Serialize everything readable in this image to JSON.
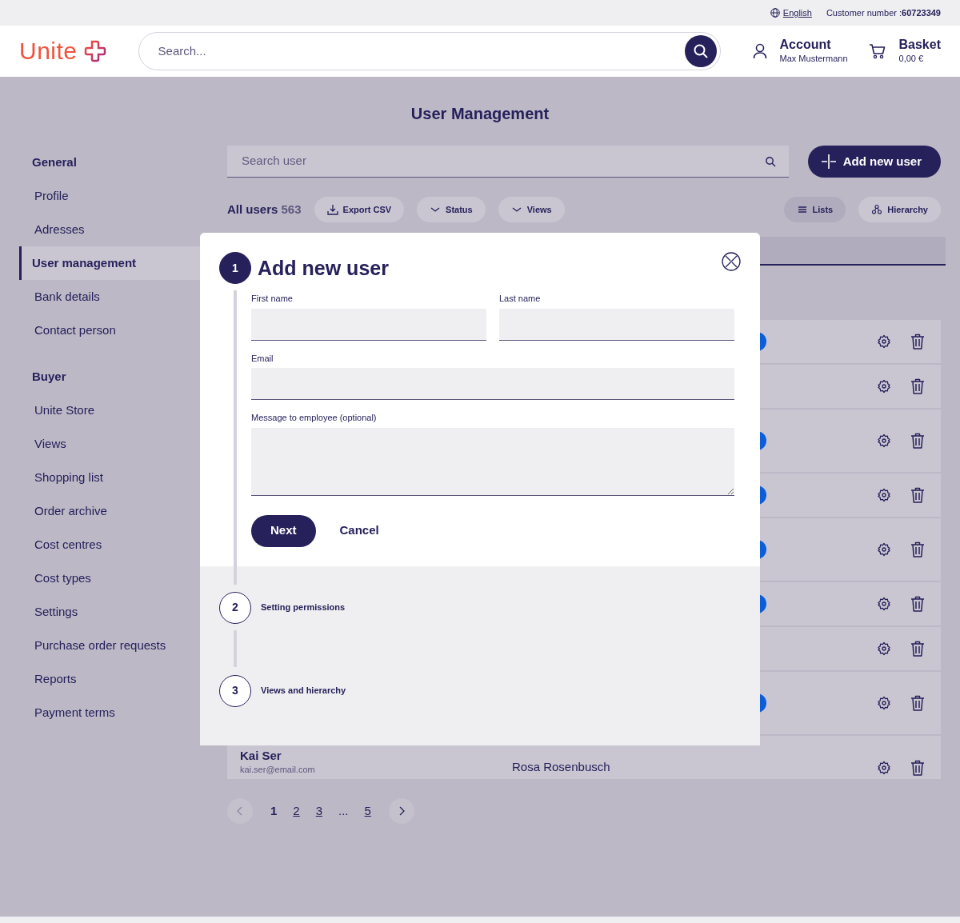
{
  "topbar": {
    "language": "English",
    "customer_label": "Customer number :",
    "customer_number": "60723349"
  },
  "header": {
    "logo": "Unite",
    "search": {
      "placeholder": "Search..."
    },
    "account": {
      "title": "Account",
      "name": "Max Mustermann"
    },
    "basket": {
      "title": "Basket",
      "amount": "0,00 €"
    }
  },
  "page_title": "User Management",
  "sidebar": [
    {
      "title": "General",
      "items": [
        {
          "label": "Profile",
          "selected": false
        },
        {
          "label": "Adresses",
          "selected": false
        },
        {
          "label": "User management",
          "selected": true
        },
        {
          "label": "Bank details",
          "selected": false
        },
        {
          "label": "Contact person",
          "selected": false
        }
      ]
    },
    {
      "title": "Buyer",
      "items": [
        {
          "label": "Unite Store",
          "selected": false
        },
        {
          "label": "Views",
          "selected": false
        },
        {
          "label": "Shopping list",
          "selected": false
        },
        {
          "label": "Order archive",
          "selected": false
        },
        {
          "label": "Cost centres",
          "selected": false
        },
        {
          "label": "Cost types",
          "selected": false
        },
        {
          "label": "Settings",
          "selected": false
        },
        {
          "label": "Purchase order requests",
          "selected": false
        },
        {
          "label": "Reports",
          "selected": false
        },
        {
          "label": "Payment terms",
          "selected": false
        }
      ]
    }
  ],
  "toolbar": {
    "search": {
      "placeholder": "Search user"
    },
    "add_button": "Add new user",
    "all_users": "All users",
    "count": "563",
    "actions": [
      {
        "kind": "export",
        "label": "Export CSV"
      },
      {
        "kind": "dropdown",
        "label": "Status"
      },
      {
        "kind": "dropdown",
        "label": "Views"
      }
    ],
    "view_toggles": [
      {
        "kind": "list",
        "label": "Lists",
        "selected": true
      },
      {
        "kind": "hierarchy",
        "label": "Hierarchy",
        "selected": false
      }
    ]
  },
  "rows": [
    {
      "tall": false,
      "marker": true
    },
    {
      "tall": false,
      "marker": false
    },
    {
      "tall": true,
      "marker": true
    },
    {
      "tall": false,
      "marker": true
    },
    {
      "tall": true,
      "marker": true
    },
    {
      "tall": false,
      "marker": true
    },
    {
      "tall": false,
      "marker": false
    },
    {
      "tall": true,
      "marker": true
    },
    {
      "tall": false,
      "marker": false,
      "name": "Kai Ser",
      "email": "kai.ser@email.com",
      "manager": "Rosa Rosenbusch"
    }
  ],
  "pagination": [
    {
      "kind": "prev"
    },
    {
      "kind": "page",
      "label": "1",
      "selected": true
    },
    {
      "kind": "page",
      "label": "2",
      "selected": false
    },
    {
      "kind": "page",
      "label": "3",
      "selected": false
    },
    {
      "kind": "ellipsis",
      "label": "..."
    },
    {
      "kind": "page",
      "label": "5",
      "selected": false
    },
    {
      "kind": "next"
    }
  ],
  "modal": {
    "steps": [
      {
        "number": "1",
        "title": "Add new user",
        "active": true
      },
      {
        "number": "2",
        "title": "Setting permissions",
        "active": false
      },
      {
        "number": "3",
        "title": "Views and hierarchy",
        "active": false
      }
    ],
    "fields": [
      {
        "kind": "input",
        "label": "First name"
      },
      {
        "kind": "input",
        "label": "Last name"
      },
      {
        "kind": "input",
        "label": "Email"
      },
      {
        "kind": "textarea",
        "label": "Message to employee (optional)"
      }
    ],
    "primary": "Next",
    "secondary": "Cancel"
  }
}
